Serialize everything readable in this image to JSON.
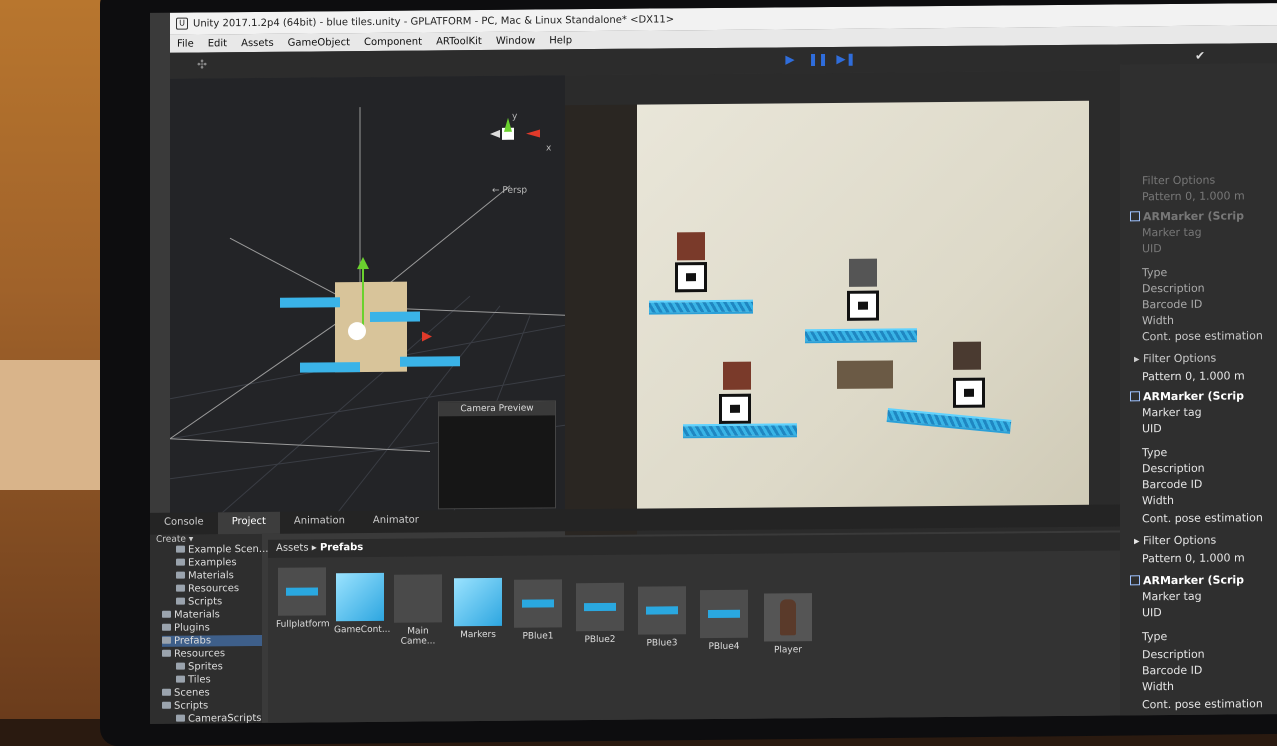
{
  "window": {
    "title": "Unity 2017.1.2p4 (64bit) - blue tiles.unity - GPLATFORM - PC, Mac & Linux Standalone* <DX11>"
  },
  "menu": [
    "File",
    "Edit",
    "Assets",
    "GameObject",
    "Component",
    "ARToolKit",
    "Window",
    "Help"
  ],
  "scene": {
    "persp_label": "← Persp",
    "axis_y": "y",
    "axis_x": "x",
    "camera_preview_title": "Camera Preview"
  },
  "bottom_tabs": [
    "Console",
    "Project",
    "Animation",
    "Animator"
  ],
  "project": {
    "create_label": "Create ▾",
    "tree": [
      "Example Scen...",
      "Examples",
      "Materials",
      "Resources",
      "Scripts",
      "Materials",
      "Plugins",
      "Prefabs",
      "Resources",
      "Sprites",
      "Tiles",
      "Scenes",
      "Scripts",
      "CameraScripts"
    ],
    "selected_index": 7,
    "breadcrumb_root": "Assets",
    "breadcrumb_sep": "▸",
    "breadcrumb_current": "Prefabs",
    "assets": [
      "Fullplatform",
      "GameCont...",
      "Main Came...",
      "Markers",
      "PBlue1",
      "PBlue2",
      "PBlue3",
      "PBlue4",
      "Player"
    ]
  },
  "inspector": {
    "top_fade": [
      "Filter Options",
      "Pattern 0, 1.000 m"
    ],
    "component_title": "ARMarker (Scrip",
    "fields": {
      "marker_tag": "Marker tag",
      "uid": "UID",
      "type": "Type",
      "description": "Description",
      "barcode_id": "Barcode ID",
      "width": "Width",
      "cont_pose": "Cont. pose estimation",
      "filter_options": "Filter Options",
      "pattern": "Pattern 0, 1.000 m"
    }
  },
  "colors": {
    "accent": "#2f6ddb",
    "platform_blue": "#39b4e6",
    "editor_bg": "#3a3a3a"
  }
}
